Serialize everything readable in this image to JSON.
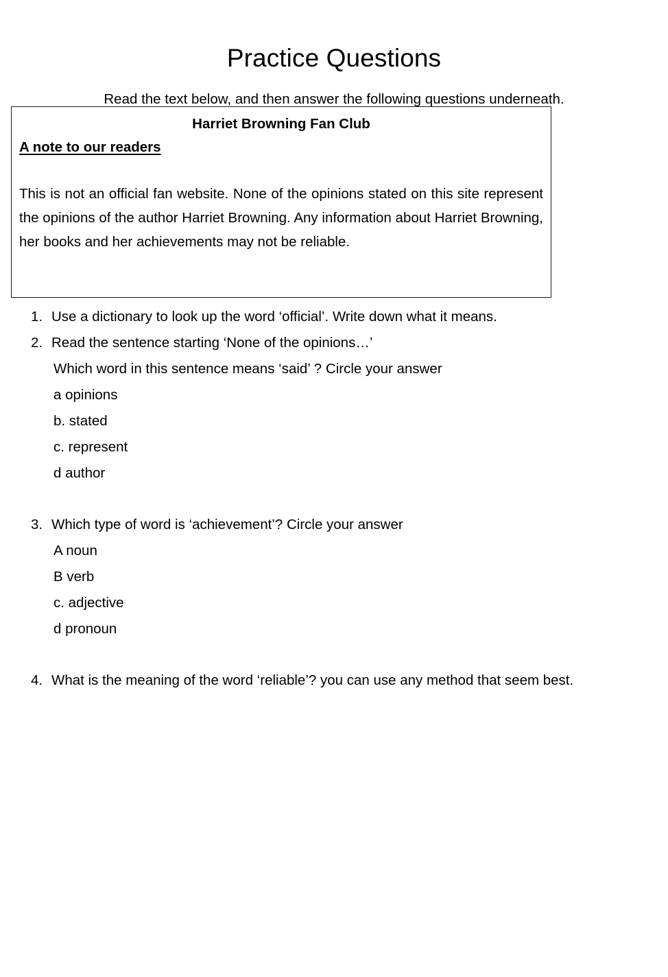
{
  "document": {
    "title": "Practice Questions",
    "instruction": "Read the text below, and then answer the following questions underneath.",
    "source_box": {
      "heading": "Harriet Browning Fan Club",
      "subheading": "A note to our readers",
      "body": "This is not an official fan website. None of the opinions stated on this site represent the opinions of the author Harriet Browning. Any information about Harriet Browning, her books and her achievements may not be reliable."
    },
    "questions": [
      {
        "number": "1.",
        "text": "Use a dictionary to look up the word ‘official’. Write down what it means.",
        "sub": "",
        "options": []
      },
      {
        "number": "2.",
        "text": "Read the sentence starting ‘None of the opinions…’",
        "sub": "Which word in this sentence means ‘said’ ? Circle your answer",
        "options": [
          "a opinions",
          "b. stated",
          "c. represent",
          "d author"
        ]
      },
      {
        "number": "3.",
        "text": "Which type of word is ‘achievement’? Circle your answer",
        "sub": "",
        "options": [
          "A noun",
          "B verb",
          "c. adjective",
          "d pronoun"
        ]
      },
      {
        "number": "4.",
        "text": "What is the meaning of the word ‘reliable’? you can use any method that seem best.",
        "sub": "",
        "options": []
      }
    ]
  },
  "colors": {
    "page_background": "#ffffff",
    "text": "#000000",
    "box_border": "#1a1a1a"
  }
}
